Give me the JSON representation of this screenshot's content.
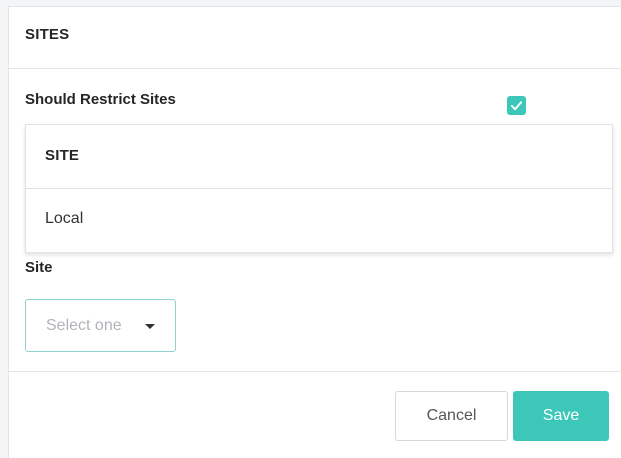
{
  "panel": {
    "title": "SITES"
  },
  "restrict": {
    "label": "Should Restrict Sites",
    "checked": true,
    "accent_color": "#3cc7b9"
  },
  "sites_table": {
    "columns": [
      "SITE"
    ],
    "rows": [
      [
        "Local"
      ]
    ]
  },
  "site_select": {
    "label": "Site",
    "placeholder": "Select one",
    "icon": "caret-down-icon"
  },
  "footer": {
    "cancel_label": "Cancel",
    "save_label": "Save"
  }
}
